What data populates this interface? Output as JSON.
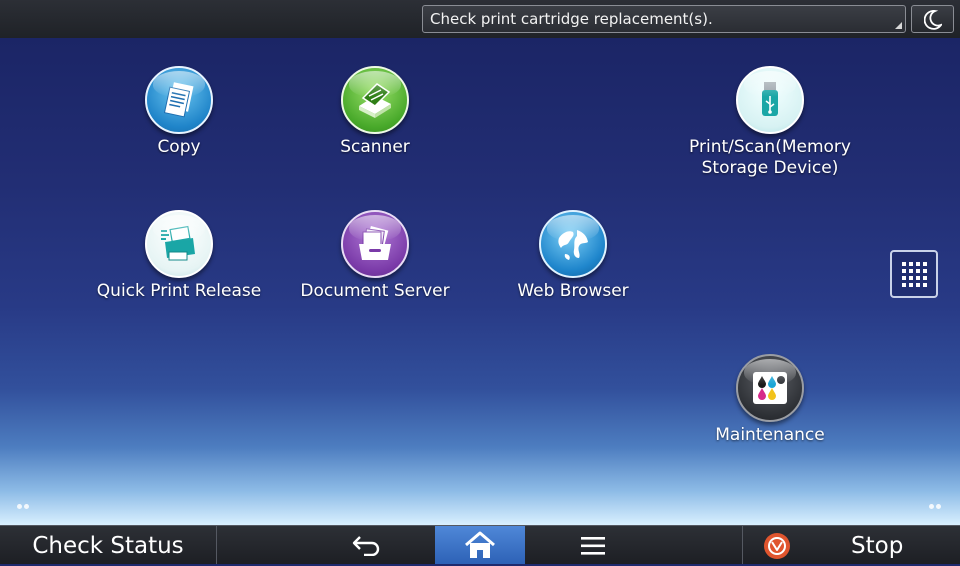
{
  "status_bar": {
    "message": "Check print cartridge replacement(s).",
    "sleep_icon": "moon-icon"
  },
  "apps": [
    {
      "label": "Copy",
      "icon": "copy-icon"
    },
    {
      "label": "Scanner",
      "icon": "scanner-icon"
    },
    {
      "label": "Print/Scan(Memory Storage Device)",
      "label_line1": "Print/Scan(Memory",
      "label_line2": "Storage Device)",
      "icon": "usb-icon"
    },
    {
      "label": "Quick Print Release",
      "icon": "printer-icon"
    },
    {
      "label": "Document Server",
      "icon": "document-server-icon"
    },
    {
      "label": "Web Browser",
      "icon": "globe-icon"
    },
    {
      "label": "Maintenance",
      "icon": "ink-drops-icon"
    }
  ],
  "bottom_bar": {
    "check_status": "Check Status",
    "stop": "Stop",
    "home_color": "#3a72c8",
    "stop_color": "#e0552e"
  },
  "colors": {
    "background_top": "#1b2566",
    "background_bottom": "#d9f0ff"
  }
}
